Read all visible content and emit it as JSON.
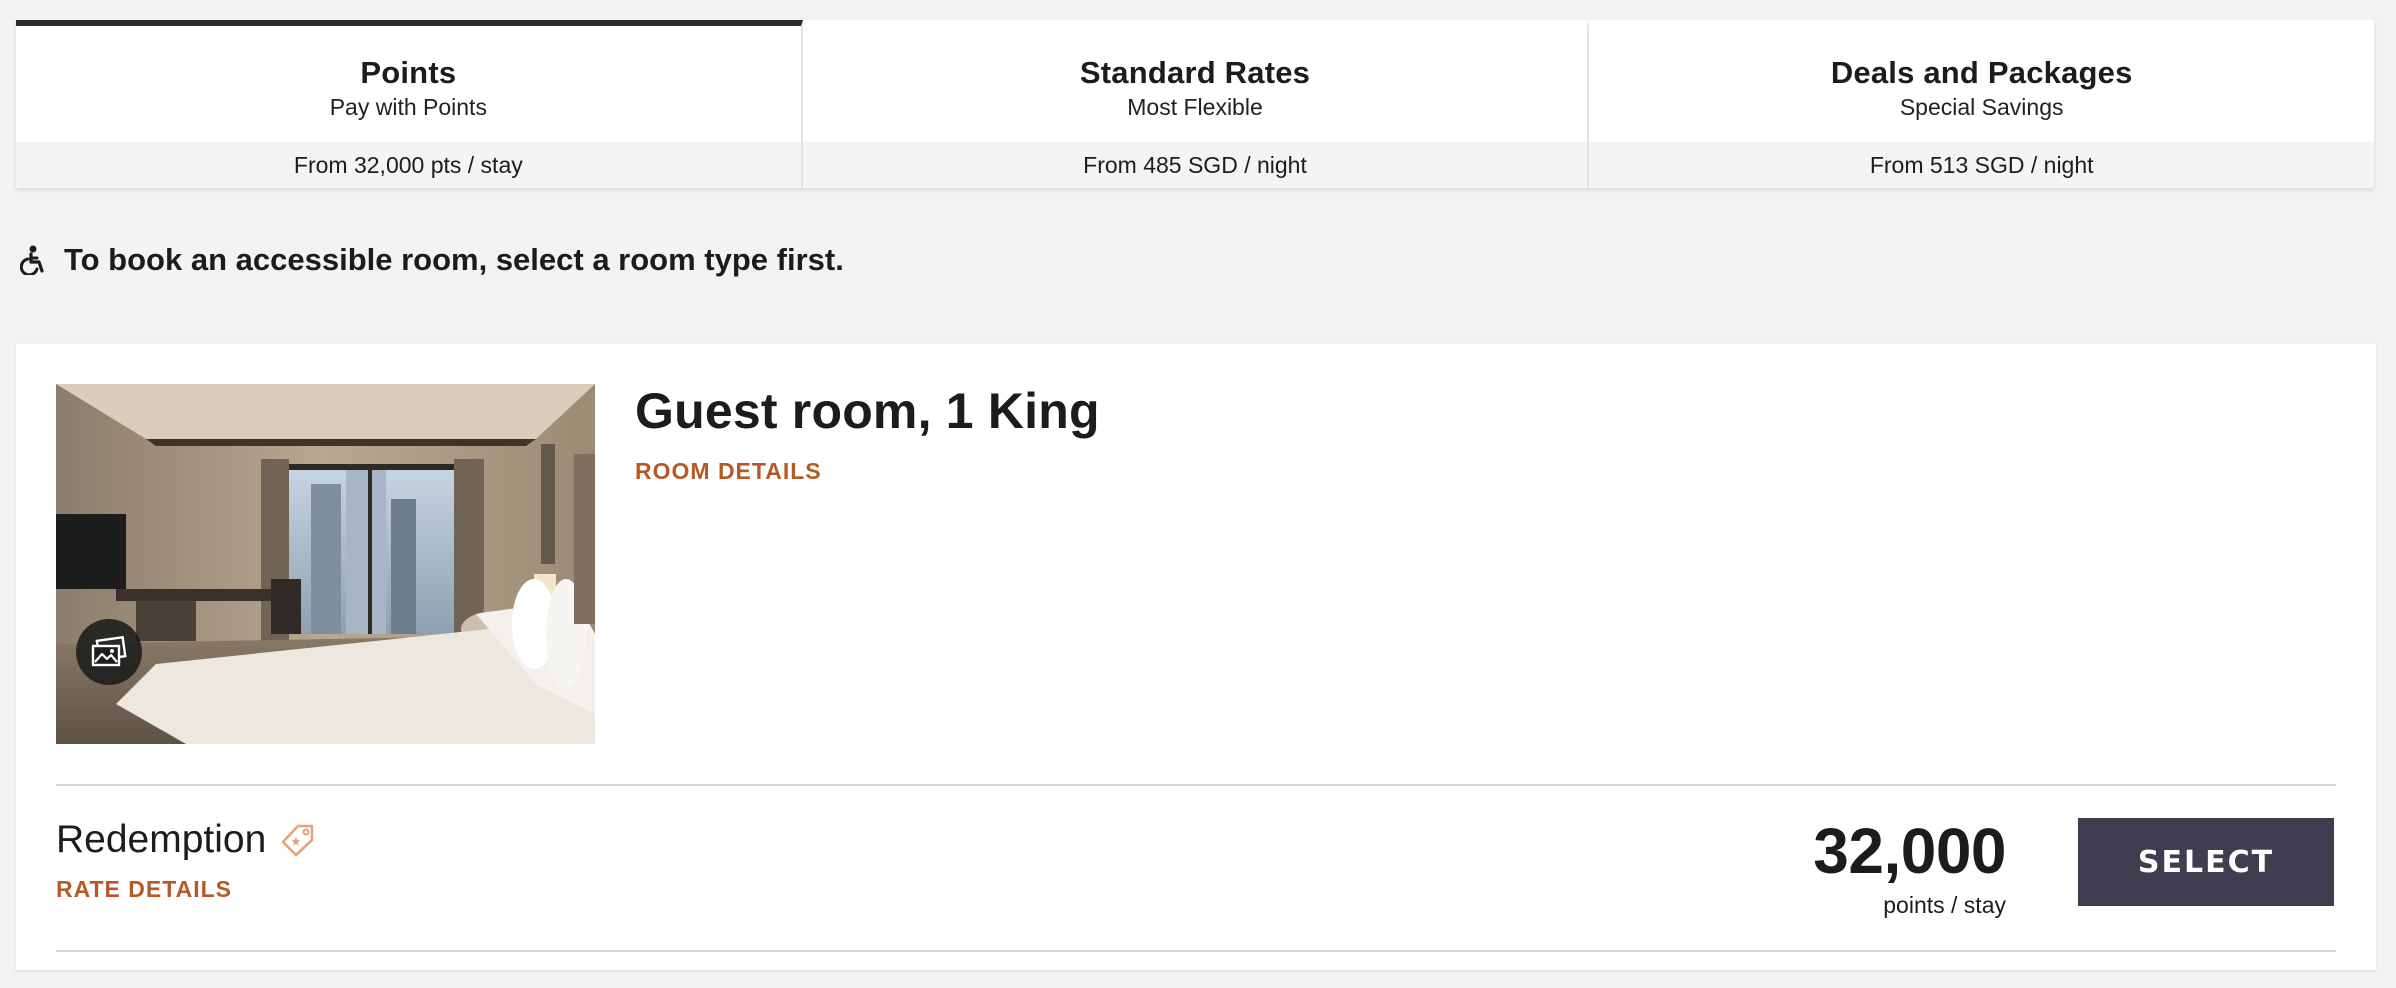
{
  "tabs": [
    {
      "title": "Points",
      "subtitle": "Pay with Points",
      "price": "From 32,000 pts / stay",
      "active": true
    },
    {
      "title": "Standard Rates",
      "subtitle": "Most Flexible",
      "price": "From 485 SGD / night",
      "active": false
    },
    {
      "title": "Deals and Packages",
      "subtitle": "Special Savings",
      "price": "From 513 SGD / night",
      "active": false
    }
  ],
  "notice": {
    "icon": "wheelchair-icon",
    "text": "To book an accessible room, select a room type first."
  },
  "room": {
    "title": "Guest room, 1 King",
    "details_link": "ROOM DETAILS",
    "photo_icon": "gallery-icon",
    "rate": {
      "name": "Redemption",
      "tag_icon": "tag-icon",
      "details_link": "RATE DETAILS",
      "price": "32,000",
      "unit": "points / stay",
      "select_label": "SELECT"
    }
  },
  "colors": {
    "accent_link": "#b55a27",
    "select_button": "#3f3d4f",
    "active_tab_border": "#2b2b2b",
    "background": "#f3f3f3"
  }
}
